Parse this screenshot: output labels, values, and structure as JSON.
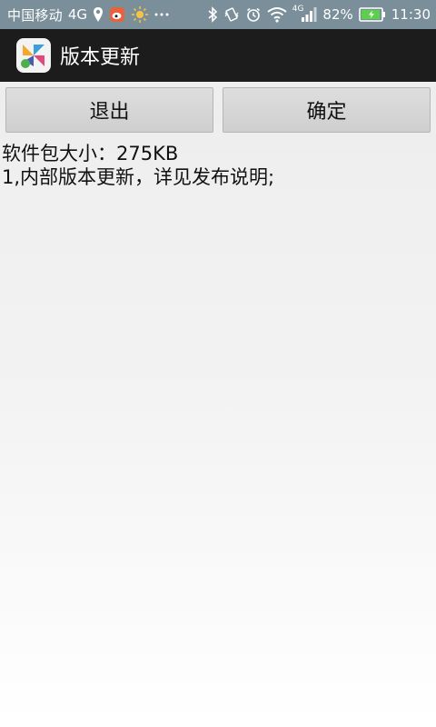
{
  "status_bar": {
    "carrier": "中国移动",
    "network": "4G",
    "battery_percent": "82%",
    "time": "11:30",
    "net_badge": "4G",
    "icons": [
      "location-icon",
      "weibo-icon",
      "sun-icon",
      "more-dots-icon",
      "bluetooth-icon",
      "vibrate-icon",
      "alarm-icon",
      "wifi-icon",
      "signal-icon",
      "battery-icon"
    ],
    "background_color": "#7a8f9a"
  },
  "action_bar": {
    "title": "版本更新",
    "background_color": "#1c1c1c"
  },
  "buttons": {
    "exit_label": "退出",
    "confirm_label": "确定"
  },
  "content": {
    "size_line": "软件包大小：275KB",
    "notes_line": "1,内部版本更新，详见发布说明;"
  }
}
